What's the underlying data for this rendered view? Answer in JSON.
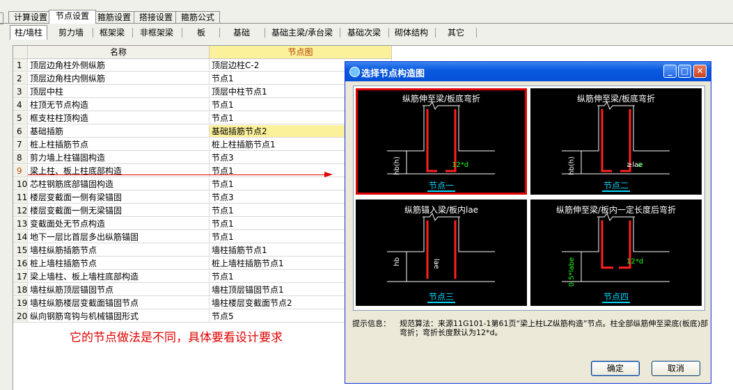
{
  "tabs_main": [
    {
      "label": "计算设置"
    },
    {
      "label": "节点设置"
    },
    {
      "label": "箍筋设置"
    },
    {
      "label": "搭接设置"
    },
    {
      "label": "箍筋公式"
    }
  ],
  "tabs_sub": [
    {
      "label": "柱/墙柱"
    },
    {
      "label": "剪力墙"
    },
    {
      "label": "框架梁"
    },
    {
      "label": "非框架梁"
    },
    {
      "label": "板"
    },
    {
      "label": "基础"
    },
    {
      "label": "基础主梁/承台梁"
    },
    {
      "label": "基础次梁"
    },
    {
      "label": "砌体结构"
    },
    {
      "label": "其它"
    }
  ],
  "grid": {
    "headers": {
      "name": "名称",
      "node": "节点图"
    },
    "rows": [
      {
        "n": "1",
        "name": "顶层边角柱外侧纵筋",
        "node": "顶层边柱C-2"
      },
      {
        "n": "2",
        "name": "顶层边角柱内侧纵筋",
        "node": "节点1"
      },
      {
        "n": "3",
        "name": "顶层中柱",
        "node": "顶层中柱节点1"
      },
      {
        "n": "4",
        "name": "柱顶无节点构造",
        "node": "节点1"
      },
      {
        "n": "5",
        "name": "框支柱柱顶构造",
        "node": "节点1"
      },
      {
        "n": "6",
        "name": "基础插筋",
        "node": "基础插筋节点2"
      },
      {
        "n": "7",
        "name": "桩上柱插筋节点",
        "node": "桩上柱插筋节点1"
      },
      {
        "n": "8",
        "name": "剪力墙上柱锚固构造",
        "node": "节点3"
      },
      {
        "n": "9",
        "name": "梁上柱、板上柱底部构造",
        "node": "节点1"
      },
      {
        "n": "10",
        "name": "芯柱钢筋底部锚固构造",
        "node": "节点1"
      },
      {
        "n": "11",
        "name": "楼层变截面一侧有梁锚固",
        "node": "节点3"
      },
      {
        "n": "12",
        "name": "楼层变截面一侧无梁锚固",
        "node": "节点1"
      },
      {
        "n": "13",
        "name": "变截面处无节点构造",
        "node": "节点1"
      },
      {
        "n": "14",
        "name": "地下一层比首层多出纵筋锚固",
        "node": "节点1"
      },
      {
        "n": "15",
        "name": "墙柱纵筋插筋节点",
        "node": "墙柱插筋节点1"
      },
      {
        "n": "16",
        "name": "桩上墙柱插筋节点",
        "node": "桩上墙柱插筋节点1"
      },
      {
        "n": "17",
        "name": "梁上墙柱、板上墙柱底部构造",
        "node": "节点1"
      },
      {
        "n": "18",
        "name": "墙柱纵筋顶层锚固节点",
        "node": "墙柱顶层锚固节点1"
      },
      {
        "n": "19",
        "name": "墙柱纵筋楼层变截面锚固节点",
        "node": "墙柱楼层变截面节点2"
      },
      {
        "n": "20",
        "name": "纵向钢筋弯钩与机械锚固形式",
        "node": "节点5"
      }
    ]
  },
  "annotation": {
    "text": "它的节点做法是不同，具体要看设计要求"
  },
  "dialog": {
    "title": "选择节点构造图",
    "options": [
      {
        "caption": "纵筋伸至梁/板底弯折",
        "label": "节点一",
        "dim1": "hb(h)",
        "dim2": "12*d"
      },
      {
        "caption": "纵筋伸至梁/板底弯折",
        "label": "节点二",
        "dim1": "hb(h)",
        "dim2": "≥lae",
        "dim3": "a"
      },
      {
        "caption": "纵筋锚入梁/板内lae",
        "label": "节点三",
        "dim1": "hb",
        "dim2": "lae"
      },
      {
        "caption": "纵筋伸至梁/板内一定长度后弯折",
        "label": "节点四",
        "dim1": "0.5*labe",
        "dim2": "12*d"
      }
    ],
    "hint_label": "提示信息：",
    "hint_text": "规范算法：来源11G101-1第61页“梁上柱LZ纵筋构造”节点。柱全部纵筋伸至梁底(板底)部弯折；弯折长度默认为12*d。",
    "ok": "确定",
    "cancel": "取消"
  }
}
